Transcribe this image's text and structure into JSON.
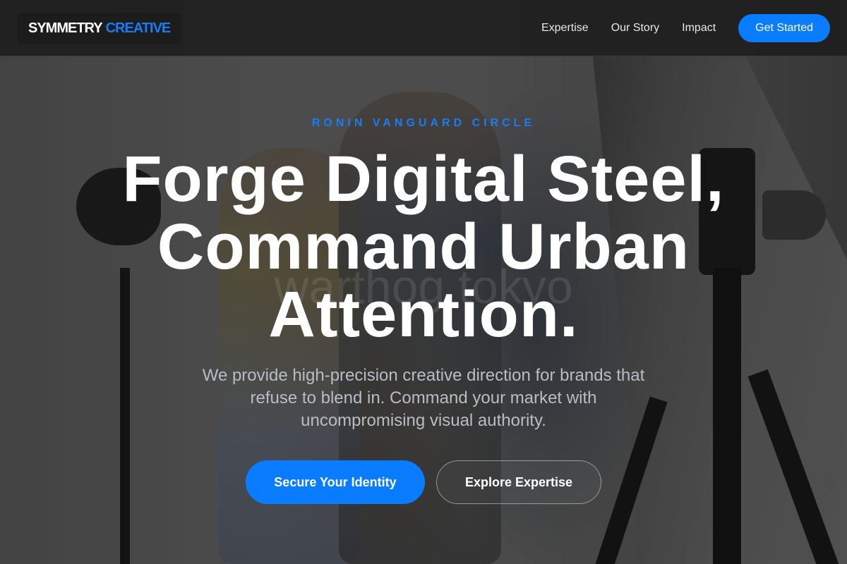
{
  "brand": {
    "name_primary": "SYMMETRY",
    "name_accent": "CREATIVE",
    "accent_color": "#1a7cf5"
  },
  "nav": {
    "links": [
      {
        "label": "Expertise"
      },
      {
        "label": "Our Story"
      },
      {
        "label": "Impact"
      }
    ],
    "cta_label": "Get Started",
    "cta_color": "#0a7cff"
  },
  "hero": {
    "eyebrow": "RONIN VANGUARD CIRCLE",
    "headline_lines": [
      "Forge Digital Steel,",
      "Command Urban",
      "Attention."
    ],
    "subtext": "We provide high-precision creative direction for brands that refuse to blend in. Command your market with uncompromising visual authority.",
    "primary_button": "Secure Your Identity",
    "secondary_button": "Explore Expertise",
    "background_watermark": "warthog tokyo"
  }
}
